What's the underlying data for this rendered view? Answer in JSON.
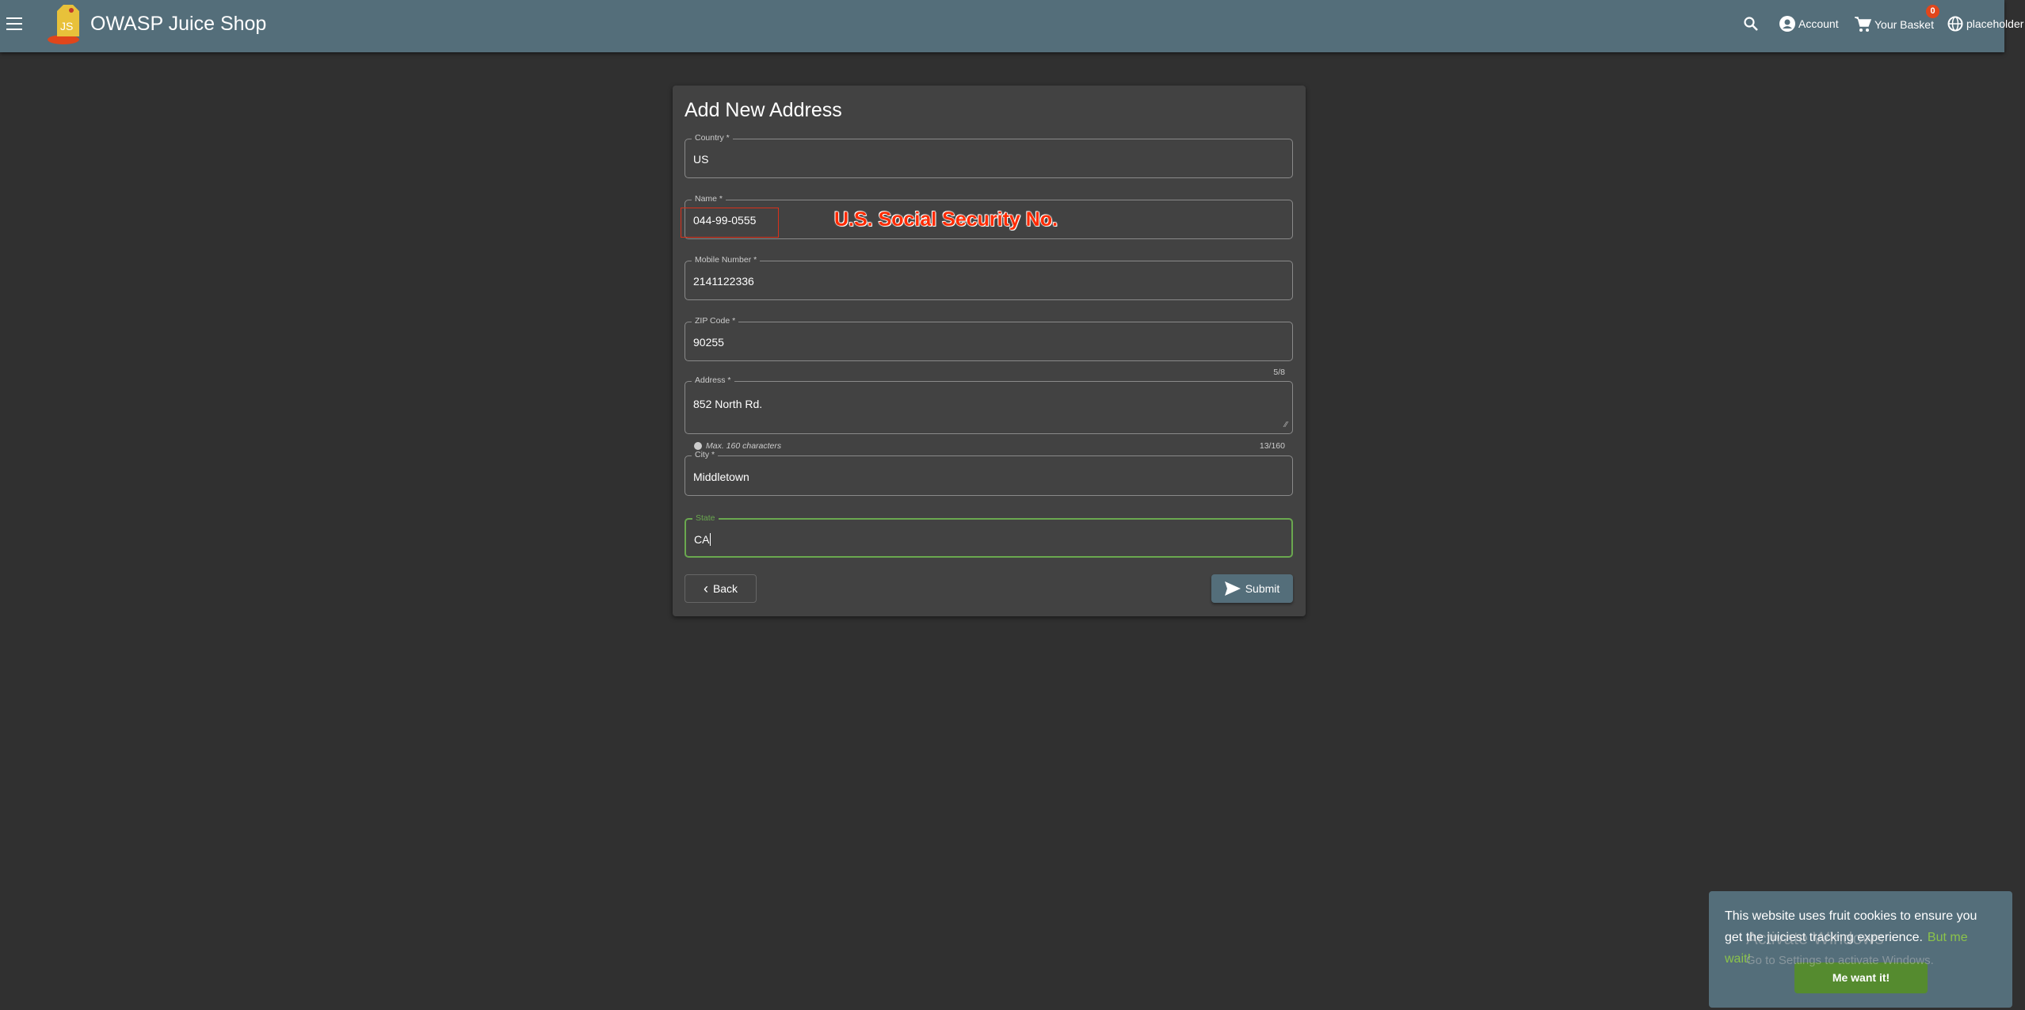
{
  "header": {
    "title": "OWASP Juice Shop",
    "account": "Account",
    "basket": "Your Basket",
    "basket_count": "0",
    "language": "placeholder"
  },
  "form": {
    "title": "Add New Address",
    "fields": [
      {
        "label": "Country *",
        "value": "US"
      },
      {
        "label": "Name *",
        "value": "044-99-0555"
      },
      {
        "label": "Mobile Number *",
        "value": "2141122336"
      },
      {
        "label": "ZIP Code *",
        "value": "90255",
        "counter": "5/8"
      },
      {
        "label": "Address *",
        "value": "852 North Rd.",
        "hint": "Max. 160 characters",
        "counter": "13/160"
      },
      {
        "label": "City *",
        "value": "Middletown"
      },
      {
        "label": "State",
        "value": "CA"
      }
    ],
    "back": "Back",
    "submit": "Submit"
  },
  "annotation": "U.S. Social Security No.",
  "cookie": {
    "text": "This website uses fruit cookies to ensure you get the juiciest tracking experience.",
    "link": "But me wait!",
    "button": "Me want it!"
  },
  "watermark": {
    "title": "Activate Windows",
    "subtitle": "Go to Settings to activate Windows."
  },
  "colors": {
    "header": "#546e7a",
    "background": "#303030",
    "card": "#424242",
    "accent_green": "#558b2f",
    "focus_border": "#6aa84f",
    "badge": "#e0461b",
    "annotation": "#ff2a00"
  }
}
